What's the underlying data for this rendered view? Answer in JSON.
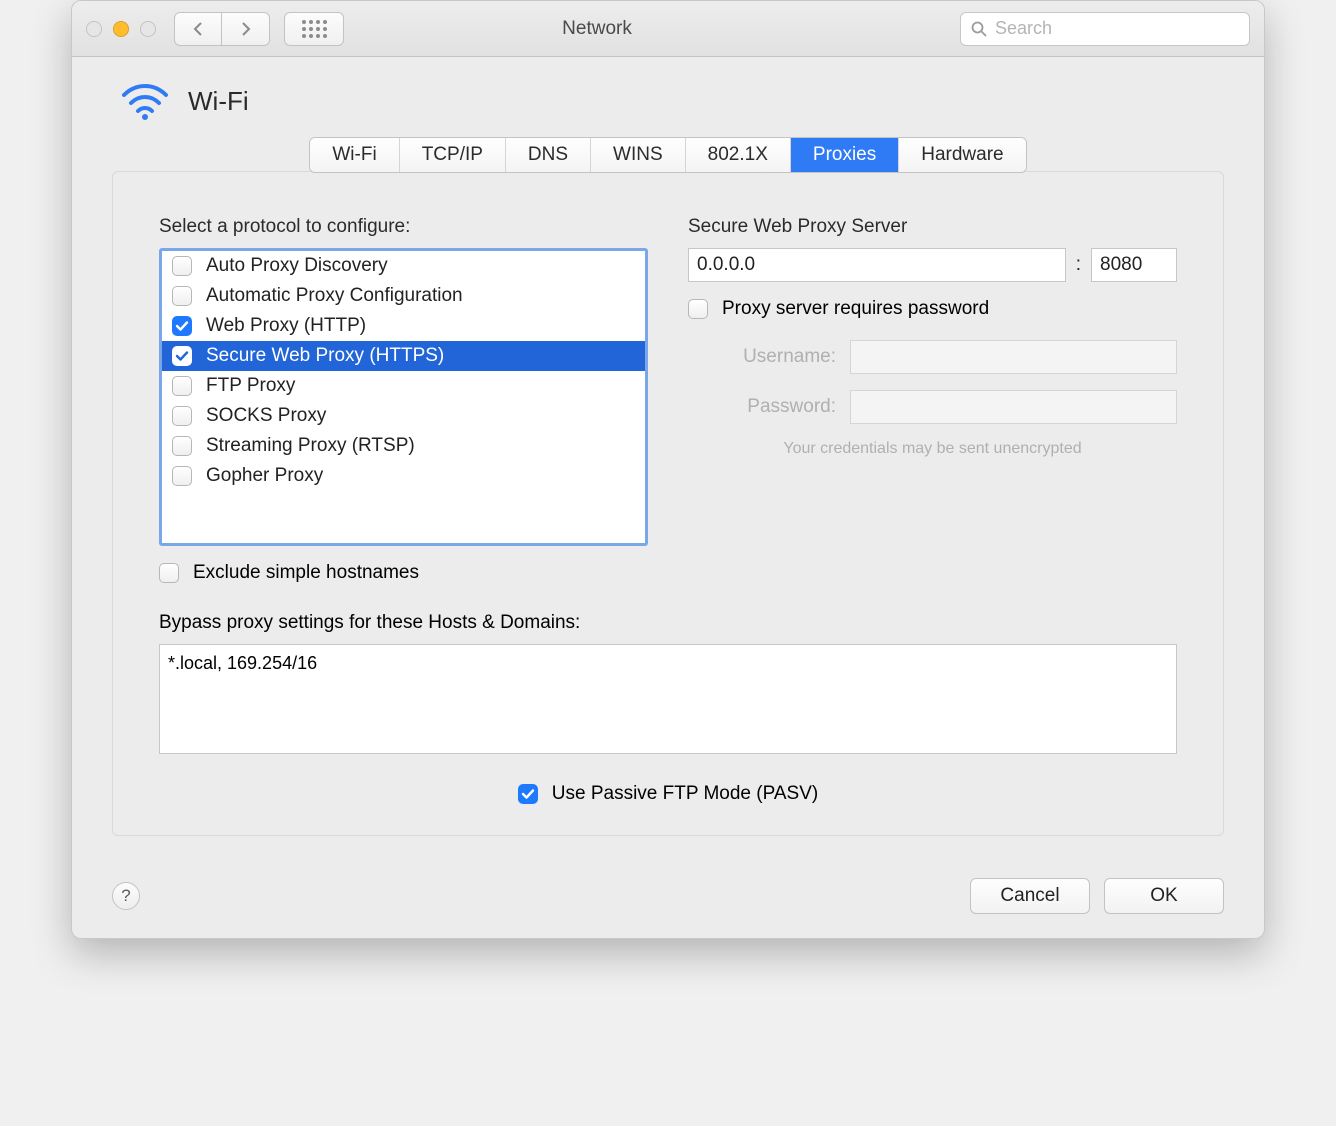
{
  "window_title": "Network",
  "search_placeholder": "Search",
  "page_header": "Wi-Fi",
  "tabs": [
    "Wi-Fi",
    "TCP/IP",
    "DNS",
    "WINS",
    "802.1X",
    "Proxies",
    "Hardware"
  ],
  "active_tab_index": 5,
  "left": {
    "heading": "Select a protocol to configure:",
    "protocols": [
      {
        "label": "Auto Proxy Discovery",
        "checked": false,
        "selected": false
      },
      {
        "label": "Automatic Proxy Configuration",
        "checked": false,
        "selected": false
      },
      {
        "label": "Web Proxy (HTTP)",
        "checked": true,
        "selected": false
      },
      {
        "label": "Secure Web Proxy (HTTPS)",
        "checked": true,
        "selected": true
      },
      {
        "label": "FTP Proxy",
        "checked": false,
        "selected": false
      },
      {
        "label": "SOCKS Proxy",
        "checked": false,
        "selected": false
      },
      {
        "label": "Streaming Proxy (RTSP)",
        "checked": false,
        "selected": false
      },
      {
        "label": "Gopher Proxy",
        "checked": false,
        "selected": false
      }
    ],
    "exclude_simple_label": "Exclude simple hostnames",
    "exclude_simple_checked": false
  },
  "right": {
    "heading": "Secure Web Proxy Server",
    "host": "0.0.0.0",
    "port": "8080",
    "requires_password_label": "Proxy server requires password",
    "requires_password_checked": false,
    "username_label": "Username:",
    "username_value": "",
    "password_label": "Password:",
    "password_value": "",
    "warning": "Your credentials may be sent unencrypted"
  },
  "bypass": {
    "label": "Bypass proxy settings for these Hosts & Domains:",
    "value": "*.local, 169.254/16"
  },
  "pasv": {
    "label": "Use Passive FTP Mode (PASV)",
    "checked": true
  },
  "footer": {
    "cancel": "Cancel",
    "ok": "OK"
  }
}
